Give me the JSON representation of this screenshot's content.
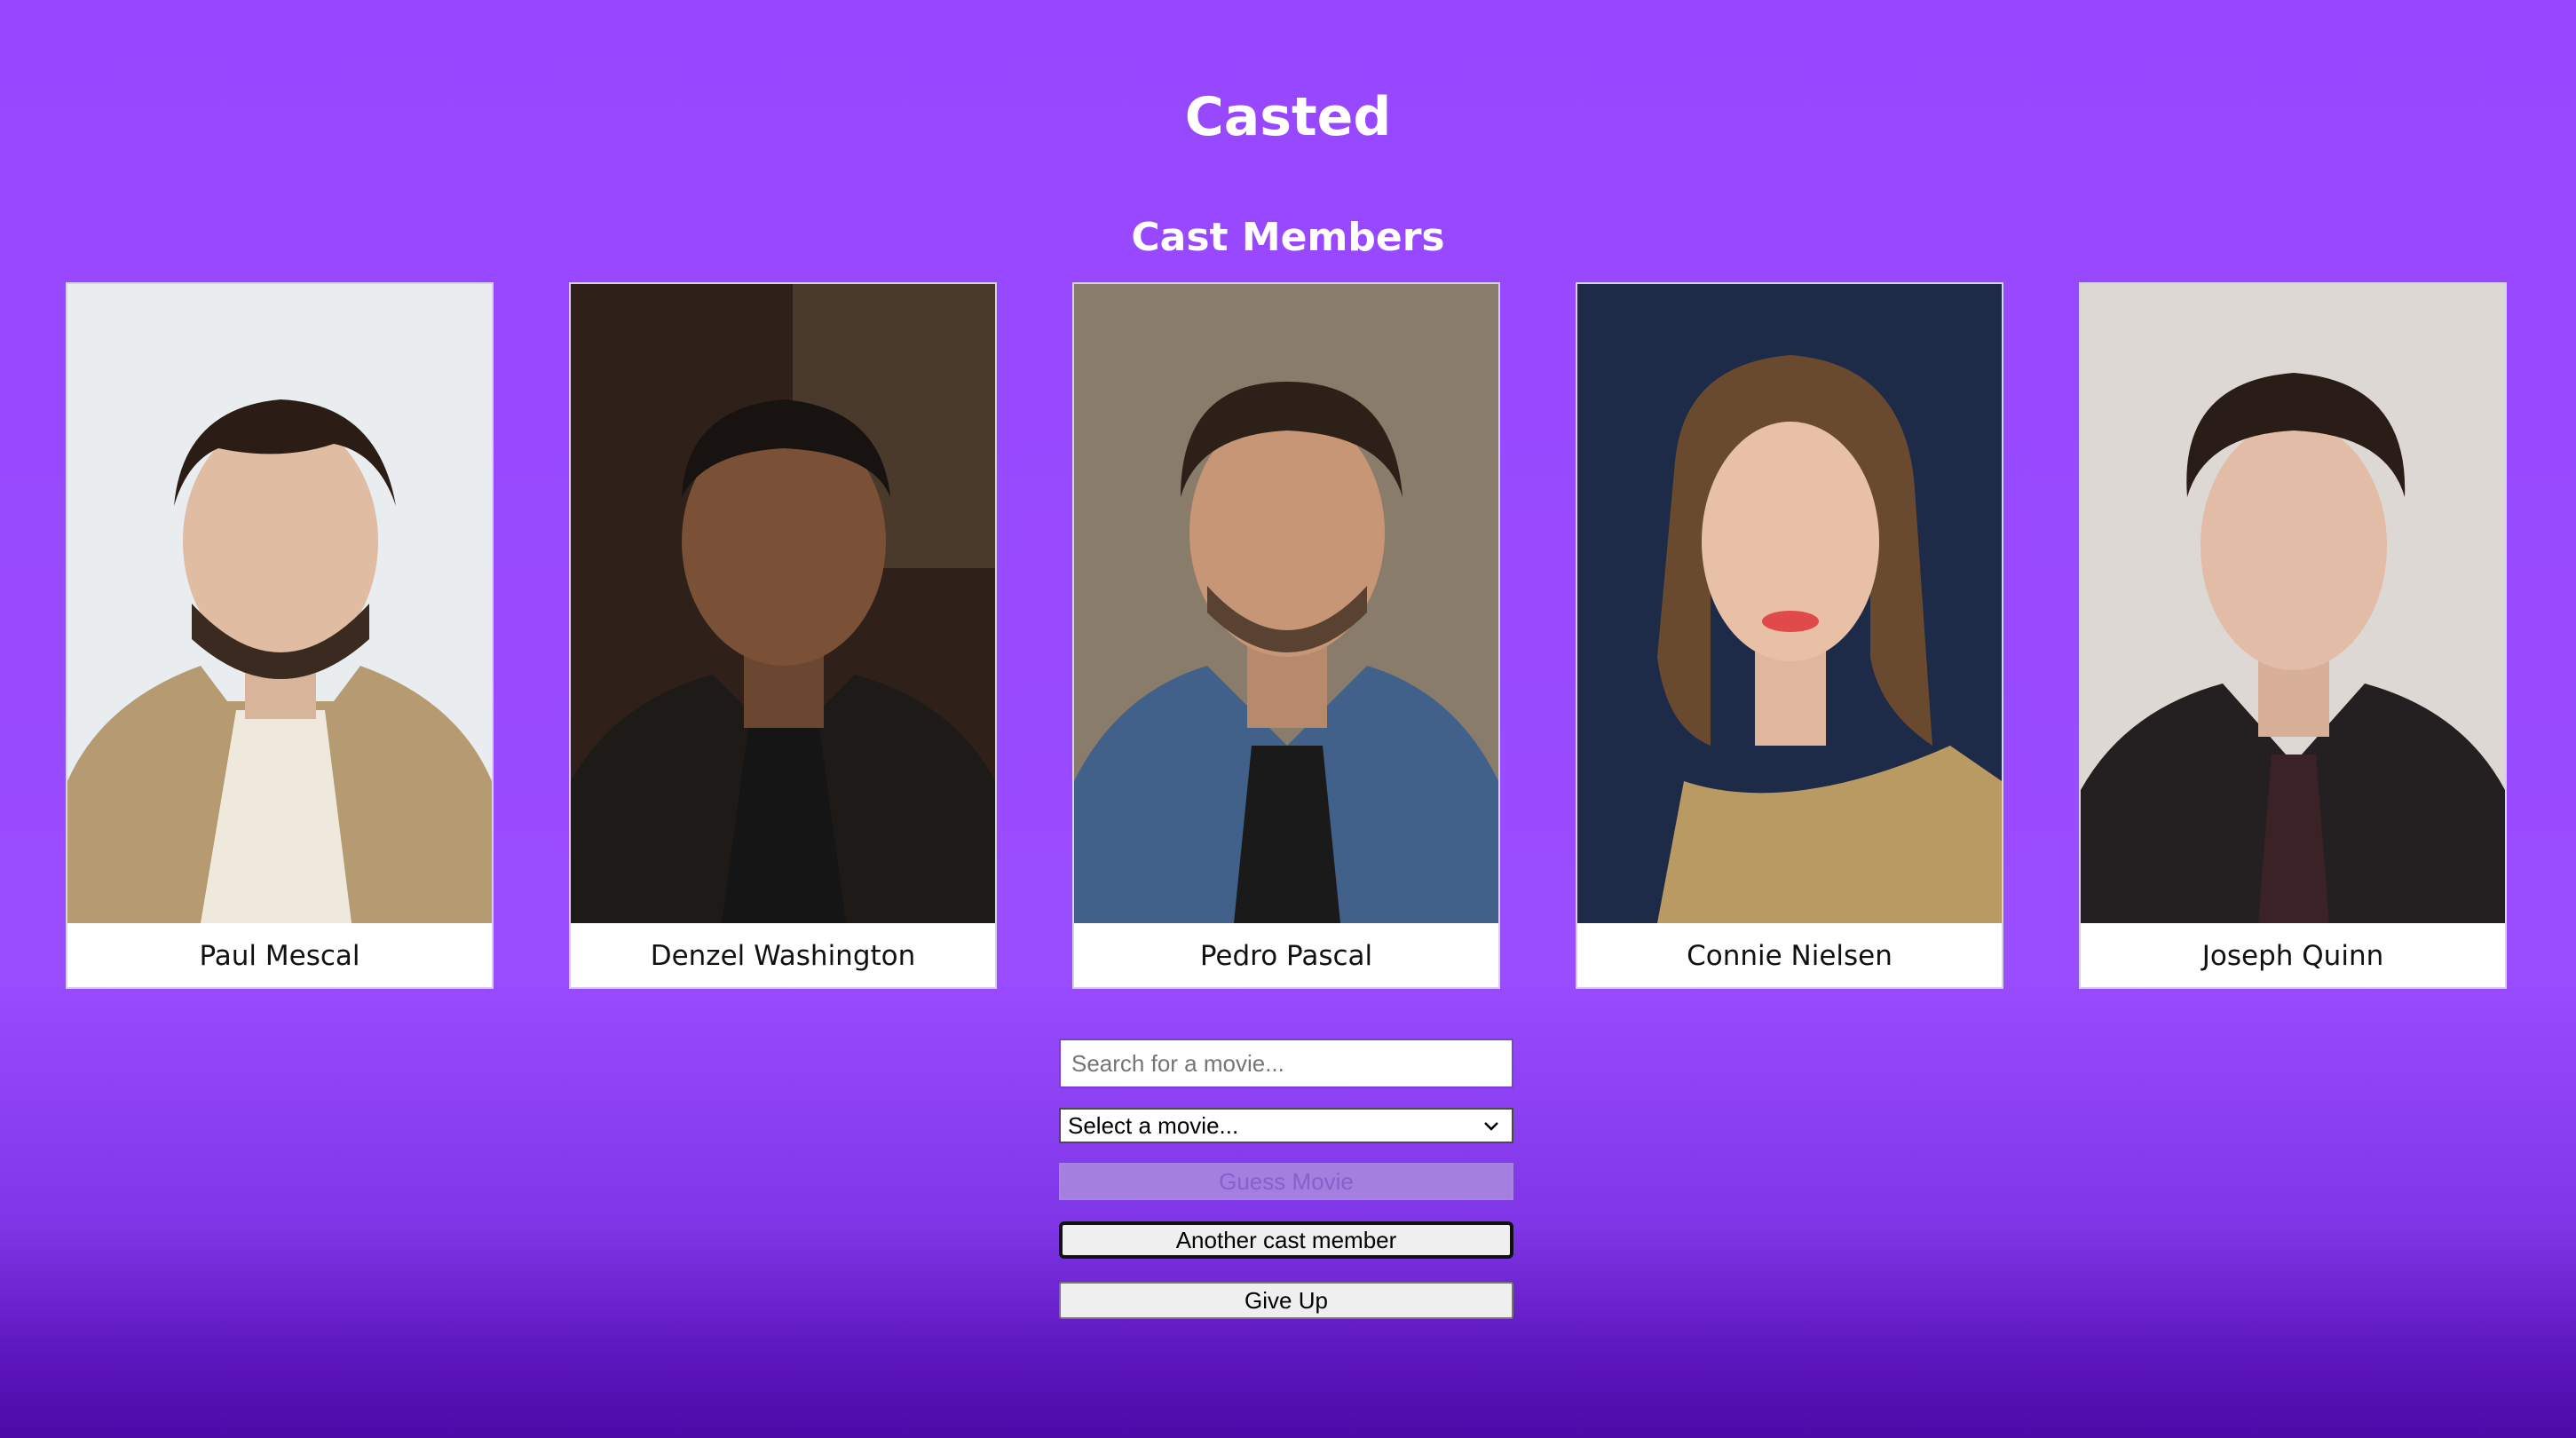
{
  "app": {
    "title": "Casted"
  },
  "cast": {
    "heading": "Cast Members",
    "members": [
      {
        "name": "Paul Mescal"
      },
      {
        "name": "Denzel Washington"
      },
      {
        "name": "Pedro Pascal"
      },
      {
        "name": "Connie Nielsen"
      },
      {
        "name": "Joseph Quinn"
      }
    ]
  },
  "controls": {
    "search": {
      "value": "",
      "placeholder": "Search for a movie..."
    },
    "select": {
      "selected": "Select a movie..."
    },
    "guess_label": "Guess Movie",
    "another_label": "Another cast member",
    "give_up_label": "Give Up"
  },
  "colors": {
    "background": "#9747ff",
    "text": "#ffffff",
    "guess_disabled": "#a47fe0"
  }
}
